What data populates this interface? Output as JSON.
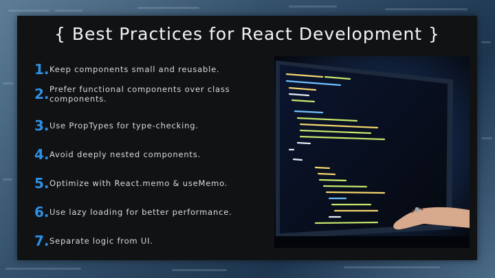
{
  "slide": {
    "title": "{ Best Practices for React Development }",
    "items": [
      {
        "number": "1.",
        "text": "Keep components small and reusable."
      },
      {
        "number": "2.",
        "text": "Prefer functional components over class components."
      },
      {
        "number": "3.",
        "text": "Use PropTypes for type-checking."
      },
      {
        "number": "4.",
        "text": "Avoid deeply nested components."
      },
      {
        "number": "5.",
        "text": "Optimize with React.memo & useMemo."
      },
      {
        "number": "6.",
        "text": "Use lazy loading for better performance."
      },
      {
        "number": "7.",
        "text": "Separate logic from UI."
      }
    ]
  },
  "image": {
    "icon": "monitor-with-code-and-hand-icon",
    "colors": {
      "accent": "#2e8fe4",
      "panel": "#101214",
      "code_green": "#c7e86b",
      "code_yellow": "#f5d76e"
    }
  }
}
